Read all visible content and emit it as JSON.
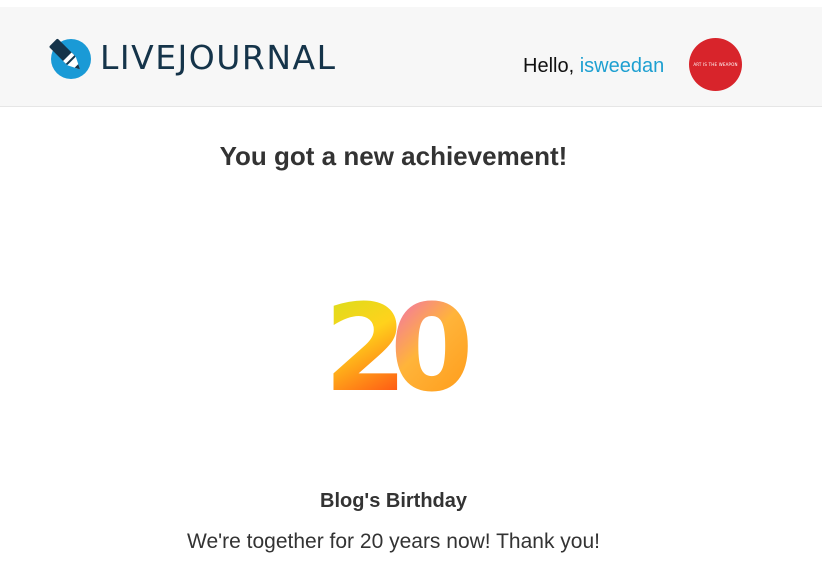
{
  "header": {
    "logo_text": "LIVEJOURNAL",
    "greeting_prefix": "Hello, ",
    "username": "isweedan",
    "avatar_text": "ART IS THE WEAPON",
    "avatar_color": "#d8242b",
    "link_color": "#1ea0d1"
  },
  "main": {
    "headline": "You got a new achievement!",
    "badge_number": "20",
    "achievement_title": "Blog's Birthday",
    "achievement_description": "We're together for 20 years now! Thank you!"
  }
}
